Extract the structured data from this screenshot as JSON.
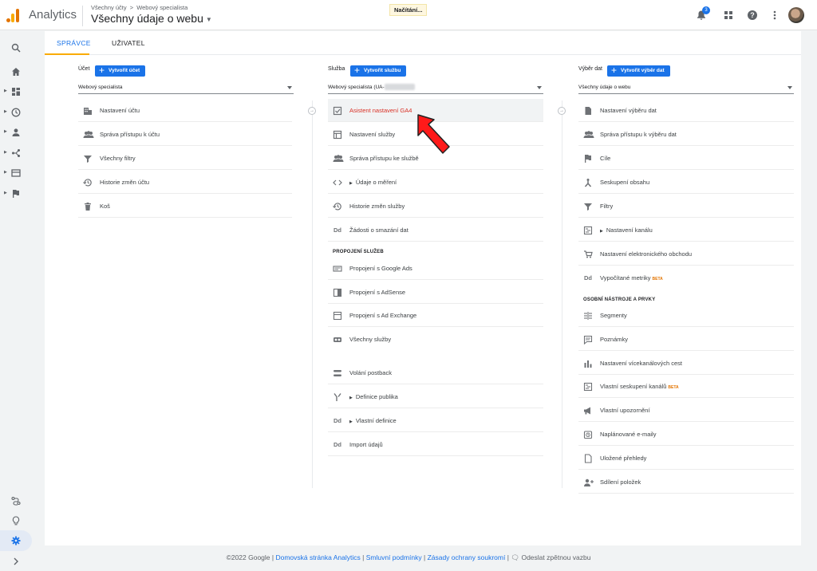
{
  "header": {
    "brand": "Analytics",
    "breadcrumb_root": "Všechny účty",
    "breadcrumb_sep": ">",
    "breadcrumb_account": "Webový specialista",
    "view_title": "Všechny údaje o webu",
    "loading": "Načítání...",
    "notification_count": "3"
  },
  "tabs": {
    "admin": "SPRÁVCE",
    "user": "UŽIVATEL"
  },
  "account_col": {
    "label": "Účet",
    "create_btn": "Vytvořit účet",
    "selected": "Webový specialista",
    "items": [
      {
        "label": "Nastavení účtu",
        "icon": "building-icon"
      },
      {
        "label": "Správa přístupu k účtu",
        "icon": "people-icon"
      },
      {
        "label": "Všechny filtry",
        "icon": "filter-icon"
      },
      {
        "label": "Historie změn účtu",
        "icon": "history-icon"
      },
      {
        "label": "Koš",
        "icon": "trash-icon"
      }
    ]
  },
  "property_col": {
    "label": "Služba",
    "create_btn": "Vytvořit službu",
    "selected": "Webový specialista (UA-",
    "items": [
      {
        "label": "Asistent nastavení GA4",
        "icon": "checkbox-icon"
      },
      {
        "label": "Nastavení služby",
        "icon": "window-icon"
      },
      {
        "label": "Správa přístupu ke službě",
        "icon": "people-icon"
      },
      {
        "label": "Údaje o měření",
        "icon": "code-icon"
      },
      {
        "label": "Historie změn služby",
        "icon": "history-icon"
      },
      {
        "label": "Žádosti o smazání dat",
        "icon": "dd-icon"
      }
    ],
    "section_links": "PROPOJENÍ SLUŽEB",
    "links": [
      {
        "label": "Propojení s Google Ads",
        "icon": "ads-icon"
      },
      {
        "label": "Propojení s AdSense",
        "icon": "adsense-icon"
      },
      {
        "label": "Propojení s Ad Exchange",
        "icon": "adexchange-icon"
      },
      {
        "label": "Všechny služby",
        "icon": "link-icon"
      }
    ],
    "extra": [
      {
        "label": "Volání postback",
        "icon": "postback-icon"
      },
      {
        "label": "Definice publika",
        "icon": "fork-icon"
      },
      {
        "label": "Vlastní definice",
        "icon": "dd-icon"
      },
      {
        "label": "Import údajů",
        "icon": "dd-icon"
      }
    ]
  },
  "view_col": {
    "label": "Výběr dat",
    "create_btn": "Vytvořit výběr dat",
    "selected": "Všechny údaje o webu",
    "items": [
      {
        "label": "Nastavení výběru dat",
        "icon": "document-icon"
      },
      {
        "label": "Správa přístupu k výběru dat",
        "icon": "people-icon"
      },
      {
        "label": "Cíle",
        "icon": "flag-icon"
      },
      {
        "label": "Seskupení obsahu",
        "icon": "grouping-icon"
      },
      {
        "label": "Filtry",
        "icon": "filter-icon"
      },
      {
        "label": "Nastavení kanálu",
        "icon": "channel-icon"
      },
      {
        "label": "Nastavení elektronického obchodu",
        "icon": "cart-icon"
      },
      {
        "label": "Vypočítané metriky",
        "icon": "dd-icon",
        "beta": "BETA"
      }
    ],
    "section_tools": "OSOBNÍ NÁSTROJE A PRVKY",
    "tools": [
      {
        "label": "Segmenty",
        "icon": "segments-icon"
      },
      {
        "label": "Poznámky",
        "icon": "comment-icon"
      },
      {
        "label": "Nastavení vícekanálových cest",
        "icon": "bar-chart-icon"
      },
      {
        "label": "Vlastní seskupení kanálů",
        "icon": "channel-icon",
        "beta": "BETA"
      },
      {
        "label": "Vlastní upozornění",
        "icon": "megaphone-icon"
      },
      {
        "label": "Naplánované e-maily",
        "icon": "clock-icon"
      },
      {
        "label": "Uložené přehledy",
        "icon": "file-icon"
      },
      {
        "label": "Sdílení položek",
        "icon": "share-icon"
      }
    ]
  },
  "footer": {
    "copyright": "©2022 Google",
    "link_home": "Domovská stránka Analytics",
    "link_terms": "Smluvní podmínky",
    "link_privacy": "Zásady ochrany soukromí",
    "feedback": "Odeslat zpětnou vazbu"
  },
  "colors": {
    "primary": "#1a73e8",
    "accent": "#f9ab00",
    "highlight": "#d93025"
  }
}
